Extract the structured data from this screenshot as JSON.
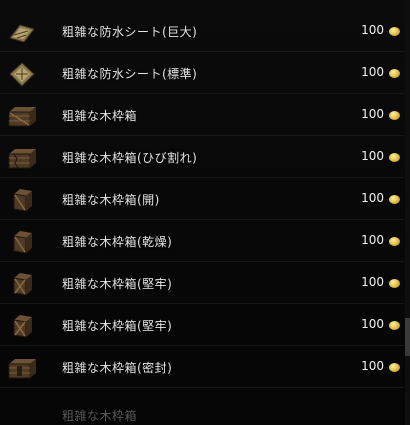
{
  "items": [
    {
      "name": "粗雑な防水シート(巨大)",
      "price": "100",
      "icon": "tarp-icon"
    },
    {
      "name": "粗雑な防水シート(標準)",
      "price": "100",
      "icon": "tarp-icon"
    },
    {
      "name": "粗雑な木枠箱",
      "price": "100",
      "icon": "crate-icon"
    },
    {
      "name": "粗雑な木枠箱(ひび割れ)",
      "price": "100",
      "icon": "crate-icon"
    },
    {
      "name": "粗雑な木枠箱(開)",
      "price": "100",
      "icon": "small-crate-icon"
    },
    {
      "name": "粗雑な木枠箱(乾燥)",
      "price": "100",
      "icon": "small-crate-icon"
    },
    {
      "name": "粗雑な木枠箱(堅牢)",
      "price": "100",
      "icon": "small-crate-icon"
    },
    {
      "name": "粗雑な木枠箱(堅牢)",
      "price": "100",
      "icon": "small-crate-icon"
    },
    {
      "name": "粗雑な木枠箱(密封)",
      "price": "100",
      "icon": "crate-icon"
    }
  ],
  "partial_item": {
    "name": "粗雑な木枠箱"
  },
  "currency_icon": "gold-coin-icon",
  "colors": {
    "background": "#050505",
    "text": "#e6e6e6",
    "coin": "#e8c447"
  }
}
